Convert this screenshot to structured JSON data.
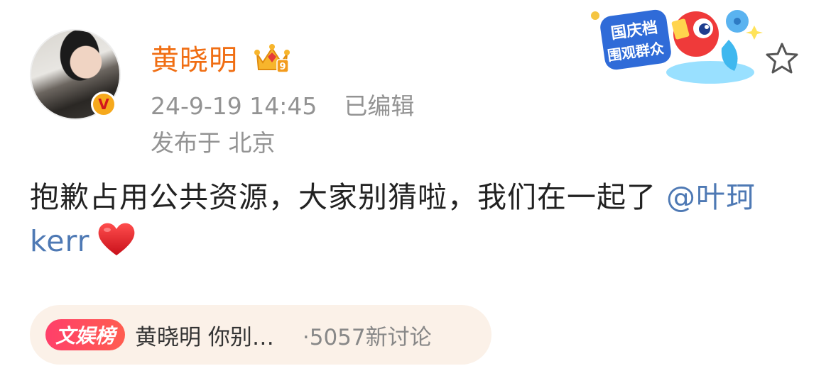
{
  "user": {
    "name": "黄晓明",
    "verified_badge": "V",
    "member_level": "9"
  },
  "meta": {
    "timestamp": "24-9-19 14:45",
    "edited": "已编辑",
    "location": "发布于 北京"
  },
  "banner": {
    "line1": "国庆档",
    "line2": "围观群众"
  },
  "post": {
    "text": "抱歉占用公共资源，大家别猜啦，我们在一起了 ",
    "mention": "@叶珂 kerr",
    "emoji": "heart"
  },
  "topic": {
    "tag": "文娱榜",
    "title": "黄晓明 你别…",
    "discussion": "·5057新讨论"
  },
  "colors": {
    "username": "#f06e13",
    "mention": "#4e79b4",
    "meta": "#939393",
    "pill_bg": "#fbf1e8",
    "tag_bg": "#ff3f6a"
  }
}
